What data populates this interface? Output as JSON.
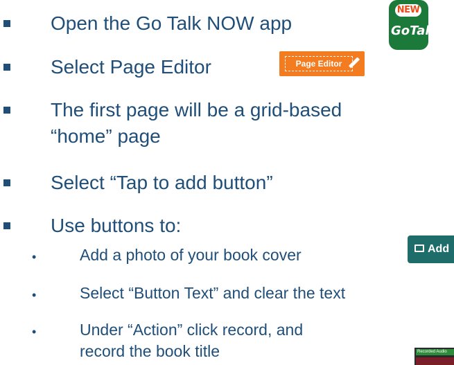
{
  "bullets": [
    {
      "text": "Open the Go Talk NOW app"
    },
    {
      "text": "Select Page Editor"
    },
    {
      "line1": "The first page will be a grid-based",
      "line2": "“home” page"
    },
    {
      "text": "Select “Tap to add button”"
    },
    {
      "text": "Use buttons to:"
    }
  ],
  "subbullets": [
    {
      "text": "Add a photo of your book cover"
    },
    {
      "text": "Select “Button Text” and clear the text"
    },
    {
      "line1": "Under “Action” click record, and",
      "line2": "record the book title"
    }
  ],
  "app_icon": {
    "new_label": "NEW",
    "go_label": "GoTalk",
    "icon": "gotalk-now-app-icon"
  },
  "page_editor_button": {
    "label": "Page Editor",
    "icon": "pencil-icon"
  },
  "add_button": {
    "label": "Add",
    "icon": "image-icon"
  },
  "audio_thumbnail": {
    "label": "Recorded Audio"
  },
  "colors": {
    "text": "#1f4e79",
    "app_green": "#1b7a3a",
    "editor_orange": "#f47c20",
    "add_teal": "#1f6d6a"
  }
}
